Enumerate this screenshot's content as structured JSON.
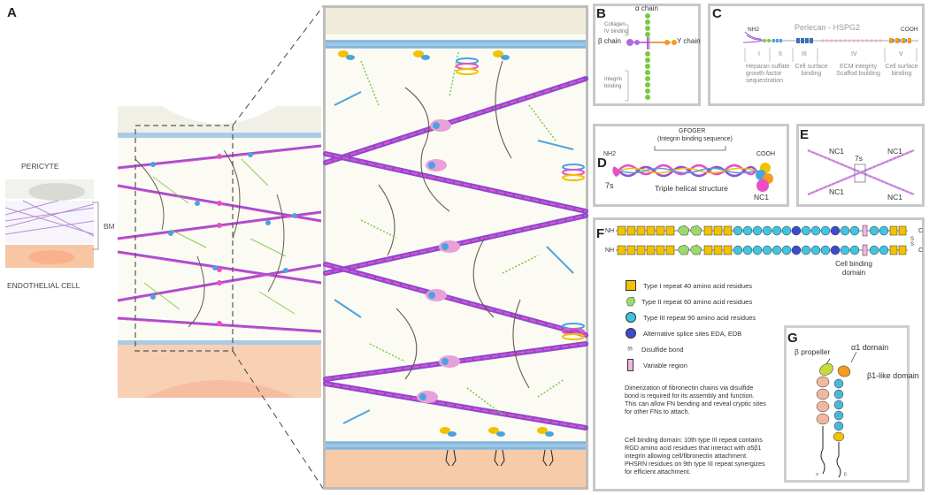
{
  "panelA": {
    "letter": "A",
    "pericyte": "PERICYTE",
    "endothelial": "ENDOTHELIAL CELL",
    "bm": "BM"
  },
  "panelB": {
    "letter": "B",
    "alpha": "α chain",
    "beta": "β chain",
    "gamma": "Y chain",
    "collagen_binding": "Collagen IV binding",
    "integrin_binding": "Integrin binding"
  },
  "panelC": {
    "letter": "C",
    "title": "Perlecan - HSPG2",
    "nh2": "NH2",
    "cooh": "COOH",
    "domains": [
      "I",
      "II",
      "III",
      "IV",
      "V"
    ],
    "desc1": "Heparan sulfate growth factor sequestration",
    "desc2": "Cell surface binding",
    "desc3": "ECM integrity Scaffod building",
    "desc4": "Cell surface binding"
  },
  "panelD": {
    "letter": "D",
    "gfoger": "GFOGER",
    "integrin_seq": "(Integrin binding sequence)",
    "nh2": "NH2",
    "cooh": "COOH",
    "s7": "7s",
    "triple": "Triple helical structure",
    "nc1": "NC1"
  },
  "panelE": {
    "letter": "E",
    "nc1": "NC1",
    "s7": "7s"
  },
  "panelF": {
    "letter": "F",
    "nh": "NH",
    "c": "C",
    "ss": "S S",
    "cell_binding": "Cell binding domain",
    "legend": [
      "Type I repeat 40 amino acid residues",
      "Type II repeat 60 amino acid residues",
      "Type III repeat 90 amino acid residues",
      "Alternative splice sites EDA, EDB",
      "Disulfide bond",
      "Variable region"
    ],
    "para1": "Dimerization of fibronectin chains via disulfide bond is required for its assembly and function. This can allow FN bending and reveal cryptic sites for other FNs to attach.",
    "para2": "Cell binding domain: 10th type III repeat contains RGD amino acid residues that interact with α5β1 integrin allowing cell/fibronectin attachment. PHSRN residues on 9th type III repeat synergizes for efficient attachment."
  },
  "panelG": {
    "letter": "G",
    "beta_propeller": "β propeller",
    "alpha1": "α1 domain",
    "beta1like": "β1-like domain",
    "a": "α",
    "b": "β"
  },
  "colors": {
    "collagen": "#9b4fd0",
    "pink": "#e84fc8",
    "green": "#7ac943",
    "blue": "#4aa3df",
    "yellow": "#f2c200",
    "peach": "#f6c7a8"
  }
}
